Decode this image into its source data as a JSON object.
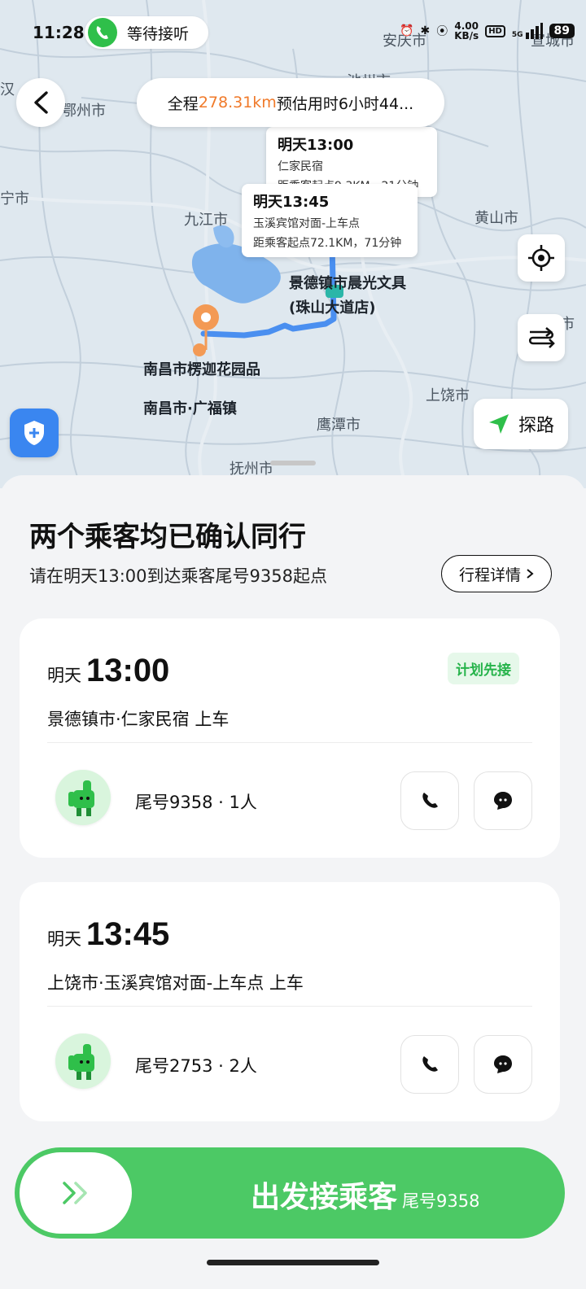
{
  "status_bar": {
    "time": "11:28",
    "call_status": "等待接听",
    "net_speed_value": "4.00",
    "net_speed_unit": "KB/s",
    "hd": "HD",
    "network": "5G",
    "battery": "89"
  },
  "map": {
    "summary_prefix": "全程",
    "summary_distance": "278.31km",
    "summary_suffix": " 预估用时6小时44...",
    "bubble1": {
      "time": "明天13:00",
      "place": "仁家民宿",
      "distance": "距乘客起点9.3KM，21分钟"
    },
    "bubble2": {
      "time": "明天13:45",
      "place": "玉溪宾馆对面-上车点",
      "distance": "距乘客起点72.1KM，71分钟"
    },
    "labels": {
      "jiujiang": "九江市",
      "huangshan": "黄山市",
      "shangrao": "上饶市",
      "yingtan": "鹰潭市",
      "fuzhou": "抚州市",
      "anqing": "安庆市",
      "chizhou": "池州市",
      "xuancheng": "宣城市",
      "han": "汉",
      "ezhou": "鄂州市",
      "xianning": "宁市",
      "chenzhou": "市"
    },
    "route_labels": {
      "dest_line1": "景德镇市晨光文具",
      "dest_line2": "(珠山大道店)",
      "origin1": "南昌市楞迦花园品",
      "origin2": "南昌市·广福镇"
    },
    "explore_label": "探路"
  },
  "sheet": {
    "title": "两个乘客均已确认同行",
    "subtitle": "请在明天13:00到达乘客尾号9358起点",
    "detail_button": "行程详情"
  },
  "passengers": [
    {
      "day": "明天",
      "time": "13:00",
      "tag": "计划先接",
      "place": "景德镇市·仁家民宿  上车",
      "info": "尾号9358 · 1人"
    },
    {
      "day": "明天",
      "time": "13:45",
      "tag": "",
      "place": "上饶市·玉溪宾馆对面-上车点  上车",
      "info": "尾号2753 · 2人"
    }
  ],
  "action": {
    "label": "出发接乘客",
    "sub_label": "尾号9358"
  },
  "colors": {
    "accent_green": "#4cc965",
    "distance_orange": "#f07a2a",
    "route_blue": "#4a8ff0",
    "shield_blue": "#3a86f0"
  }
}
